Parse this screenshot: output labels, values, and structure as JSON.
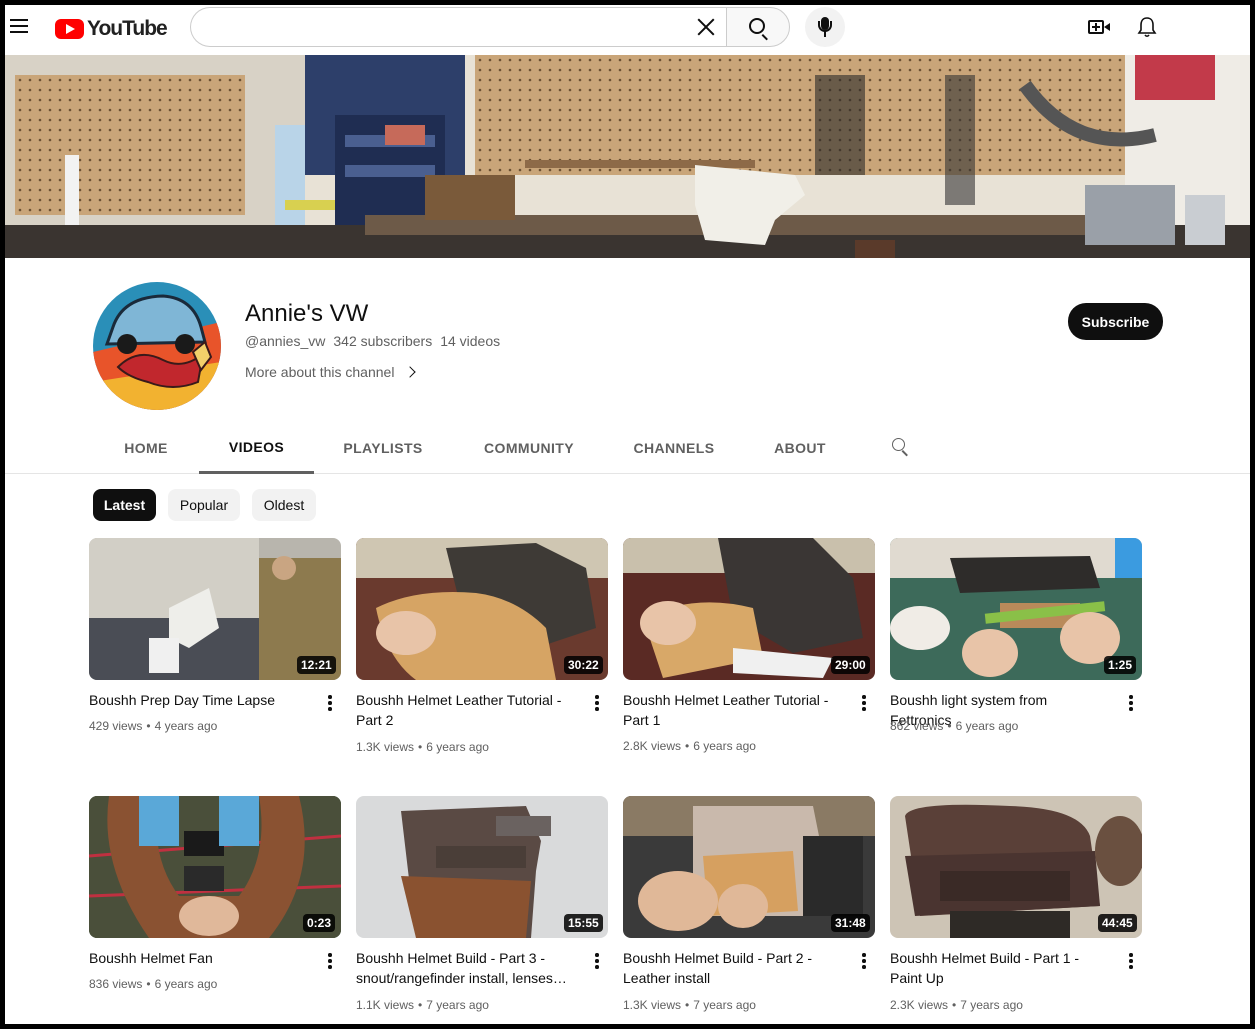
{
  "brand": {
    "logo_text": "YouTube",
    "accent": "#ff0000"
  },
  "search": {
    "placeholder": "",
    "value": ""
  },
  "channel": {
    "name": "Annie's VW",
    "handle": "@annies_vw",
    "subscribers": "342 subscribers",
    "videos_count": "14 videos",
    "more_about": "More about this channel",
    "subscribe_label": "Subscribe"
  },
  "tabs": [
    {
      "label": "HOME"
    },
    {
      "label": "VIDEOS"
    },
    {
      "label": "PLAYLISTS"
    },
    {
      "label": "COMMUNITY"
    },
    {
      "label": "CHANNELS"
    },
    {
      "label": "ABOUT"
    }
  ],
  "active_tab": "VIDEOS",
  "chips": [
    {
      "label": "Latest"
    },
    {
      "label": "Popular"
    },
    {
      "label": "Oldest"
    }
  ],
  "active_chip": "Latest",
  "videos": [
    {
      "title": "Boushh Prep Day Time Lapse",
      "duration": "12:21",
      "views": "429 views",
      "age": "4 years ago"
    },
    {
      "title": "Boushh Helmet Leather Tutorial - Part 2",
      "duration": "30:22",
      "views": "1.3K views",
      "age": "6 years ago"
    },
    {
      "title": "Boushh Helmet Leather Tutorial - Part 1",
      "duration": "29:00",
      "views": "2.8K views",
      "age": "6 years ago"
    },
    {
      "title": "Boushh light system from Fettronics",
      "duration": "1:25",
      "views": "862 views",
      "age": "6 years ago"
    },
    {
      "title": "Boushh Helmet Fan",
      "duration": "0:23",
      "views": "836 views",
      "age": "6 years ago"
    },
    {
      "title": "Boushh Helmet Build - Part 3 - snout/rangefinder install, lenses…",
      "duration": "15:55",
      "views": "1.1K views",
      "age": "7 years ago"
    },
    {
      "title": "Boushh Helmet Build - Part 2 - Leather install",
      "duration": "31:48",
      "views": "1.3K views",
      "age": "7 years ago"
    },
    {
      "title": "Boushh Helmet Build - Part 1 - Paint Up",
      "duration": "44:45",
      "views": "2.3K views",
      "age": "7 years ago"
    }
  ]
}
